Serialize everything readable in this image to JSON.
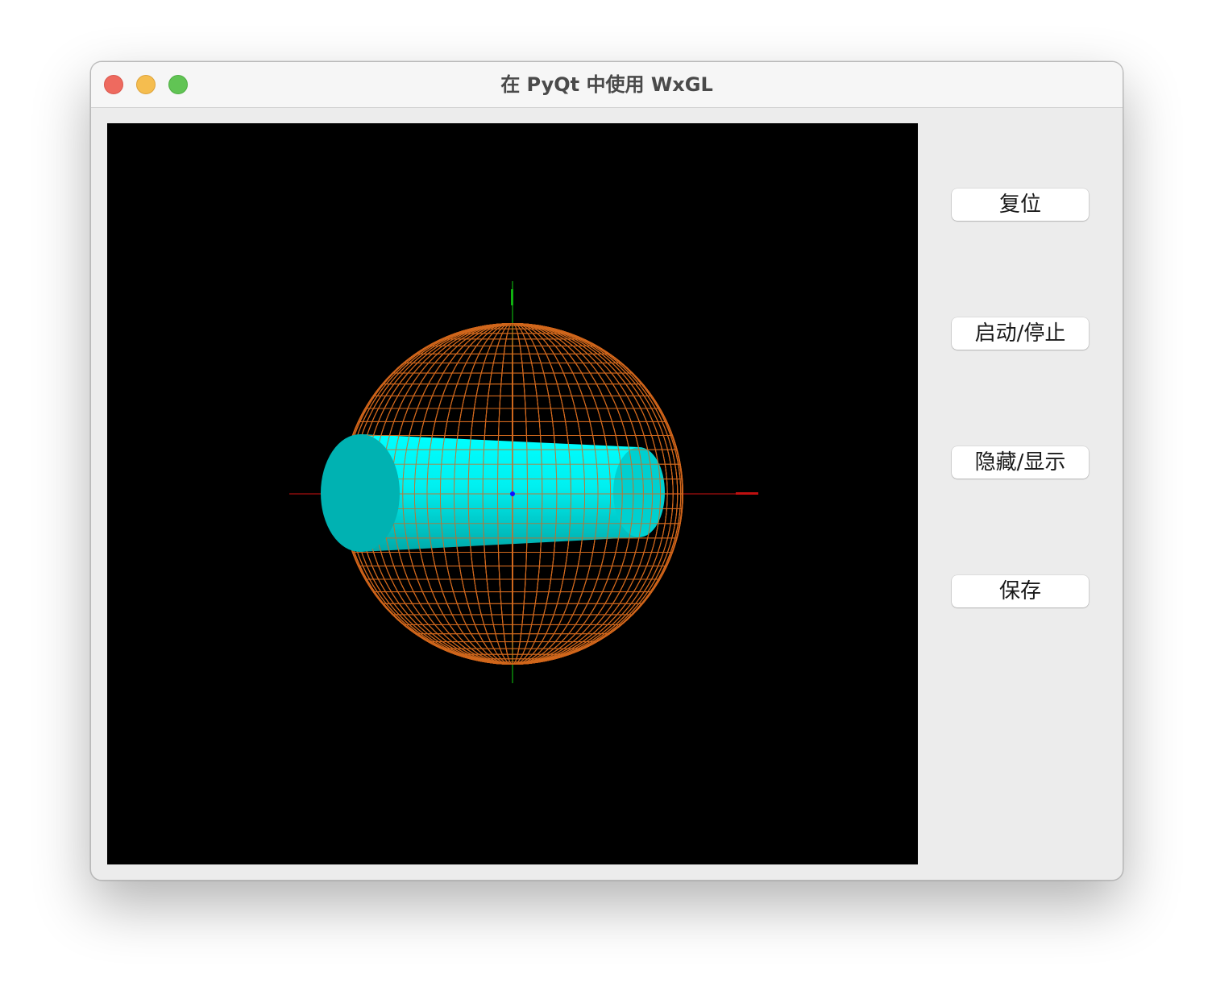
{
  "window": {
    "title": "在 PyQt 中使用 WxGL"
  },
  "buttons": {
    "reset": "复位",
    "start_stop": "启动/停止",
    "hide_show": "隐藏/显示",
    "save": "保存"
  },
  "scene": {
    "background": "#000000",
    "sphere_color": "#d2691e",
    "cylinder_color": "#00ffff",
    "cylinder_cap_color": "#00b2b2",
    "x_axis_color": "#a01010",
    "y_axis_color": "#10a010",
    "z_axis_color": "#1010ff"
  },
  "traffic_lights": {
    "close_color": "#ee6a5f",
    "minimize_color": "#f5bd4f",
    "maximize_color": "#61c454"
  }
}
